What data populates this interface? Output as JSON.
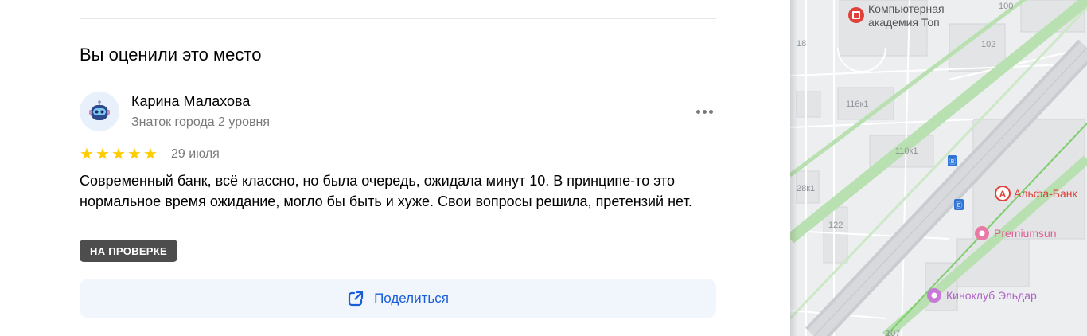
{
  "section": {
    "title": "Вы оценили это место"
  },
  "review": {
    "author_name": "Карина Малахова",
    "author_level": "Знаток города 2 уровня",
    "rating": 5,
    "stars": "★★★★★",
    "date": "29 июля",
    "text": "Современный банк, всё классно, но была очередь, ожидала минут 10. В принципе-то это нормальное время ожидание, могло бы быть и хуже. Свои вопросы решила, претензий нет.",
    "status_badge": "НА ПРОВЕРКЕ",
    "more_icon": "more-dots-icon"
  },
  "share": {
    "label": "Поделиться",
    "icon": "share-icon"
  },
  "map": {
    "pois": [
      {
        "name_line1": "Компьютерная",
        "name_line2": "академия Топ",
        "icon": "education-icon",
        "color": "#e0413a"
      },
      {
        "name": "Альфа-Банк",
        "icon": "alfa-bank-icon",
        "color": "#e0413a"
      },
      {
        "name": "Premiumsun",
        "icon": "beauty-icon",
        "color": "#e87aa8"
      },
      {
        "name": "Киноклуб Эльдар",
        "icon": "cinema-icon",
        "color": "#c77ad6"
      }
    ],
    "house_numbers": [
      "100",
      "18",
      "102",
      "116к1",
      "110к1",
      "28к1",
      "122",
      "107"
    ]
  },
  "colors": {
    "accent": "#1a5fd6",
    "star": "#ffcc00",
    "badge_bg": "#4d4d4d",
    "share_bg": "#f1f6fd"
  }
}
